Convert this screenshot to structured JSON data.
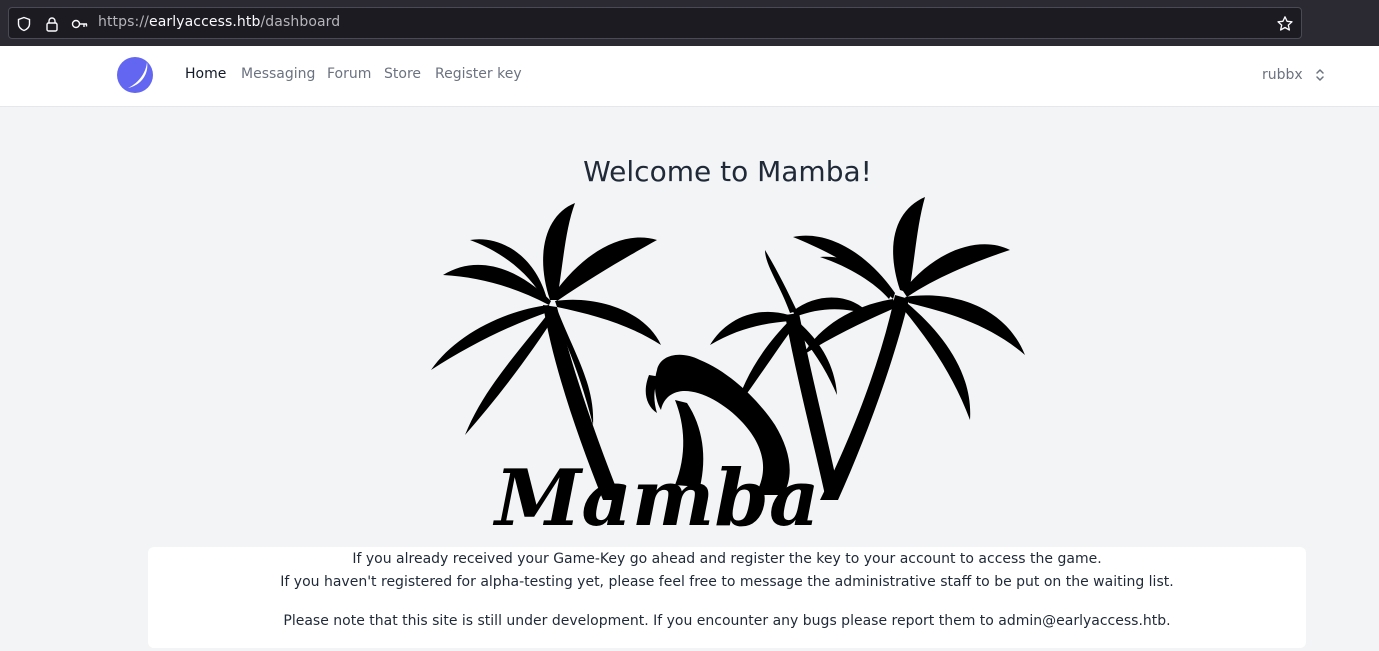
{
  "browser": {
    "url_scheme": "https://",
    "url_host": "earlyaccess.htb",
    "url_path": "/dashboard",
    "icons": [
      "shield-icon",
      "lock-icon",
      "key-icon",
      "star-icon"
    ]
  },
  "nav": {
    "links": [
      "Home",
      "Messaging",
      "Forum",
      "Store",
      "Register key"
    ],
    "active": "Home",
    "user": "rubbx",
    "accent_color": "#6366f1"
  },
  "main": {
    "title": "Welcome to Mamba!",
    "logo_word": "Mamba",
    "info": {
      "line1": "If you already received your Game-Key go ahead and register the key to your account to access the game.",
      "line2": "If you haven't registered for alpha-testing yet, please feel free to message the administrative staff to be put on the waiting list.",
      "line3": "Please note that this site is still under development. If you encounter any bugs please report them to admin@earlyaccess.htb."
    }
  }
}
